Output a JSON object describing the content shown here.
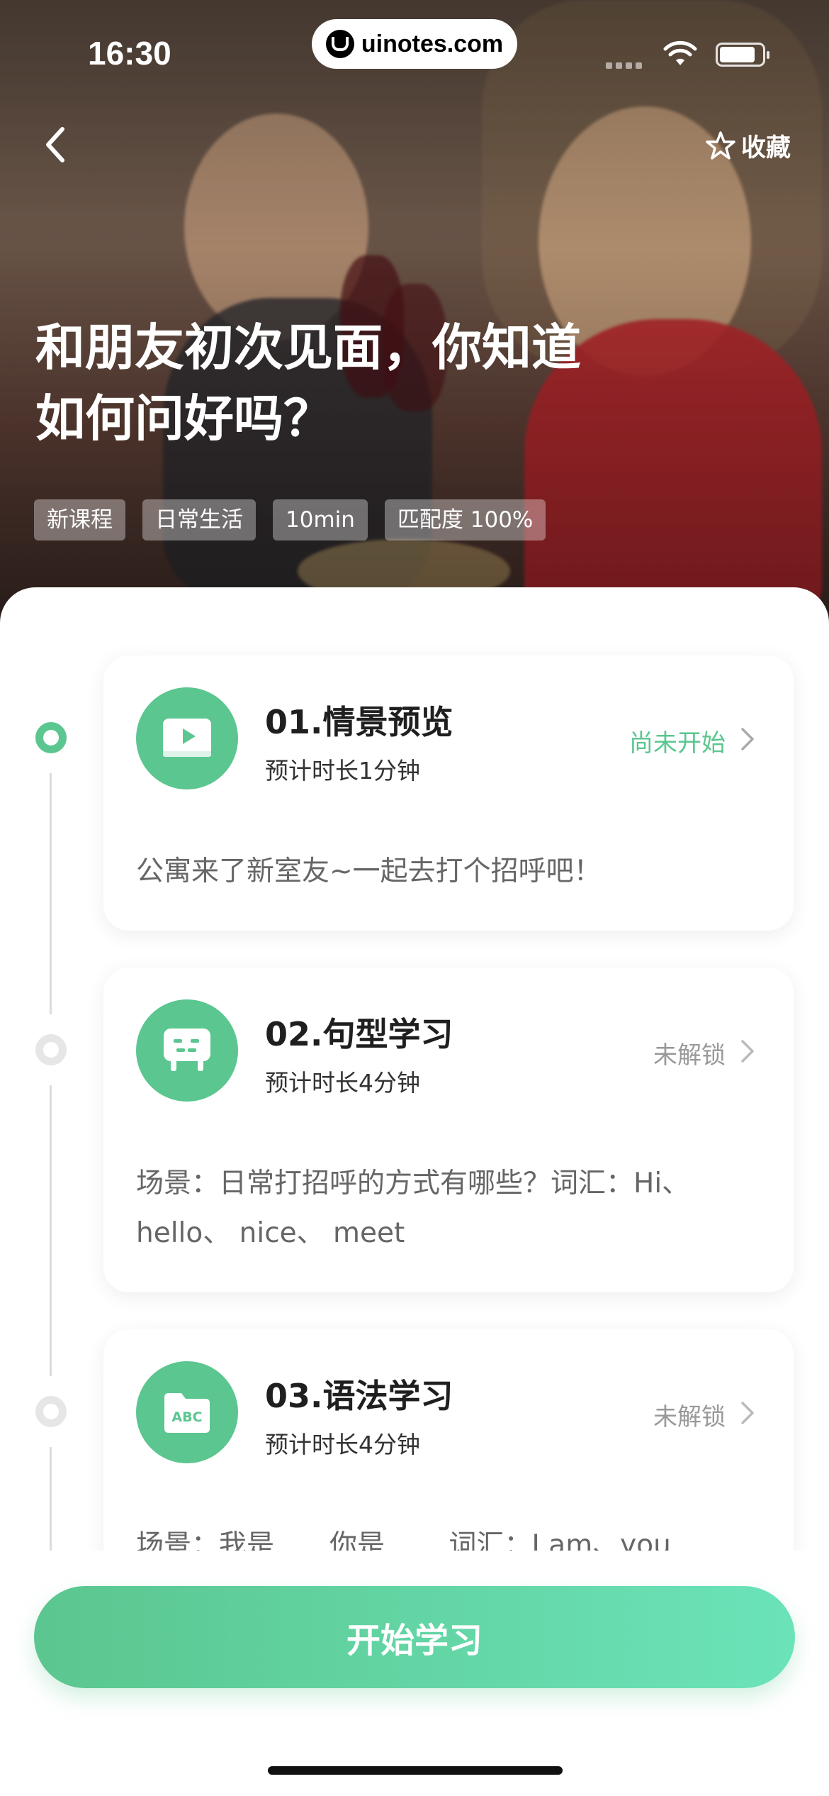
{
  "status_bar": {
    "time": "16:30",
    "domain": "uinotes.com"
  },
  "header": {
    "favorite_label": "收藏"
  },
  "course": {
    "title_line1": "和朋友初次见面，你知道",
    "title_line2": "如何问好吗？",
    "tags": [
      "新课程",
      "日常生活",
      "10min",
      "匹配度 100%"
    ]
  },
  "lessons": [
    {
      "title": "01.情景预览",
      "duration": "预计时长1分钟",
      "status": "尚未开始",
      "description": "公寓来了新室友~一起去打个招呼吧！",
      "icon": "video-play-icon",
      "unlocked": true
    },
    {
      "title": "02.句型学习",
      "duration": "预计时长4分钟",
      "status": "未解锁",
      "description": "场景：日常打招呼的方式有哪些？词汇：Hi、hello、 nice、 meet",
      "icon": "chat-bubble-icon",
      "unlocked": false
    },
    {
      "title": "03.语法学习",
      "duration": "预计时长4分钟",
      "status": "未解锁",
      "description": "场景：我是……你是……  词汇：I am、you",
      "icon": "abc-folder-icon",
      "unlocked": false
    }
  ],
  "icon_labels": {
    "abc": "ABC"
  },
  "footer": {
    "start_label": "开始学习"
  },
  "colors": {
    "accent": "#5bc68f",
    "accent_light": "#6be3b9",
    "locked_text": "#999999"
  }
}
